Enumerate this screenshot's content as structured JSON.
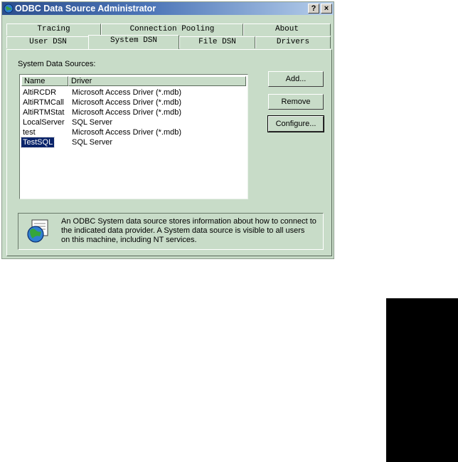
{
  "window": {
    "title": "ODBC Data Source Administrator",
    "help_button": "?",
    "close_button": "×"
  },
  "tabs": {
    "back_row": [
      "Tracing",
      "Connection Pooling",
      "About"
    ],
    "front_row": [
      "User DSN",
      "System DSN",
      "File DSN",
      "Drivers"
    ],
    "selected": "System DSN"
  },
  "section_label": "System Data Sources:",
  "list": {
    "headers": [
      "Name",
      "Driver"
    ],
    "rows": [
      {
        "name": "AltiRCDR",
        "driver": "Microsoft Access Driver (*.mdb)"
      },
      {
        "name": "AltiRTMCall",
        "driver": "Microsoft Access Driver (*.mdb)"
      },
      {
        "name": "AltiRTMStat",
        "driver": "Microsoft Access Driver (*.mdb)"
      },
      {
        "name": "LocalServer",
        "driver": "SQL Server"
      },
      {
        "name": "test",
        "driver": "Microsoft Access Driver (*.mdb)"
      },
      {
        "name": "TestSQL",
        "driver": "SQL Server"
      }
    ],
    "selected_row": "TestSQL"
  },
  "buttons": {
    "add": "Add...",
    "remove": "Remove",
    "configure": "Configure..."
  },
  "info": {
    "icon": "odbc-globe-icon",
    "line1": "An ODBC System data source stores information about how to connect to",
    "line2": "the indicated data provider.  A System data source is visible to all users",
    "line3": "on this machine, including NT services."
  },
  "colors": {
    "dialog_bg": "#c8dcc8",
    "title_start": "#2d4f8e",
    "title_end": "#b8d0ec",
    "selection": "#0a246a"
  }
}
